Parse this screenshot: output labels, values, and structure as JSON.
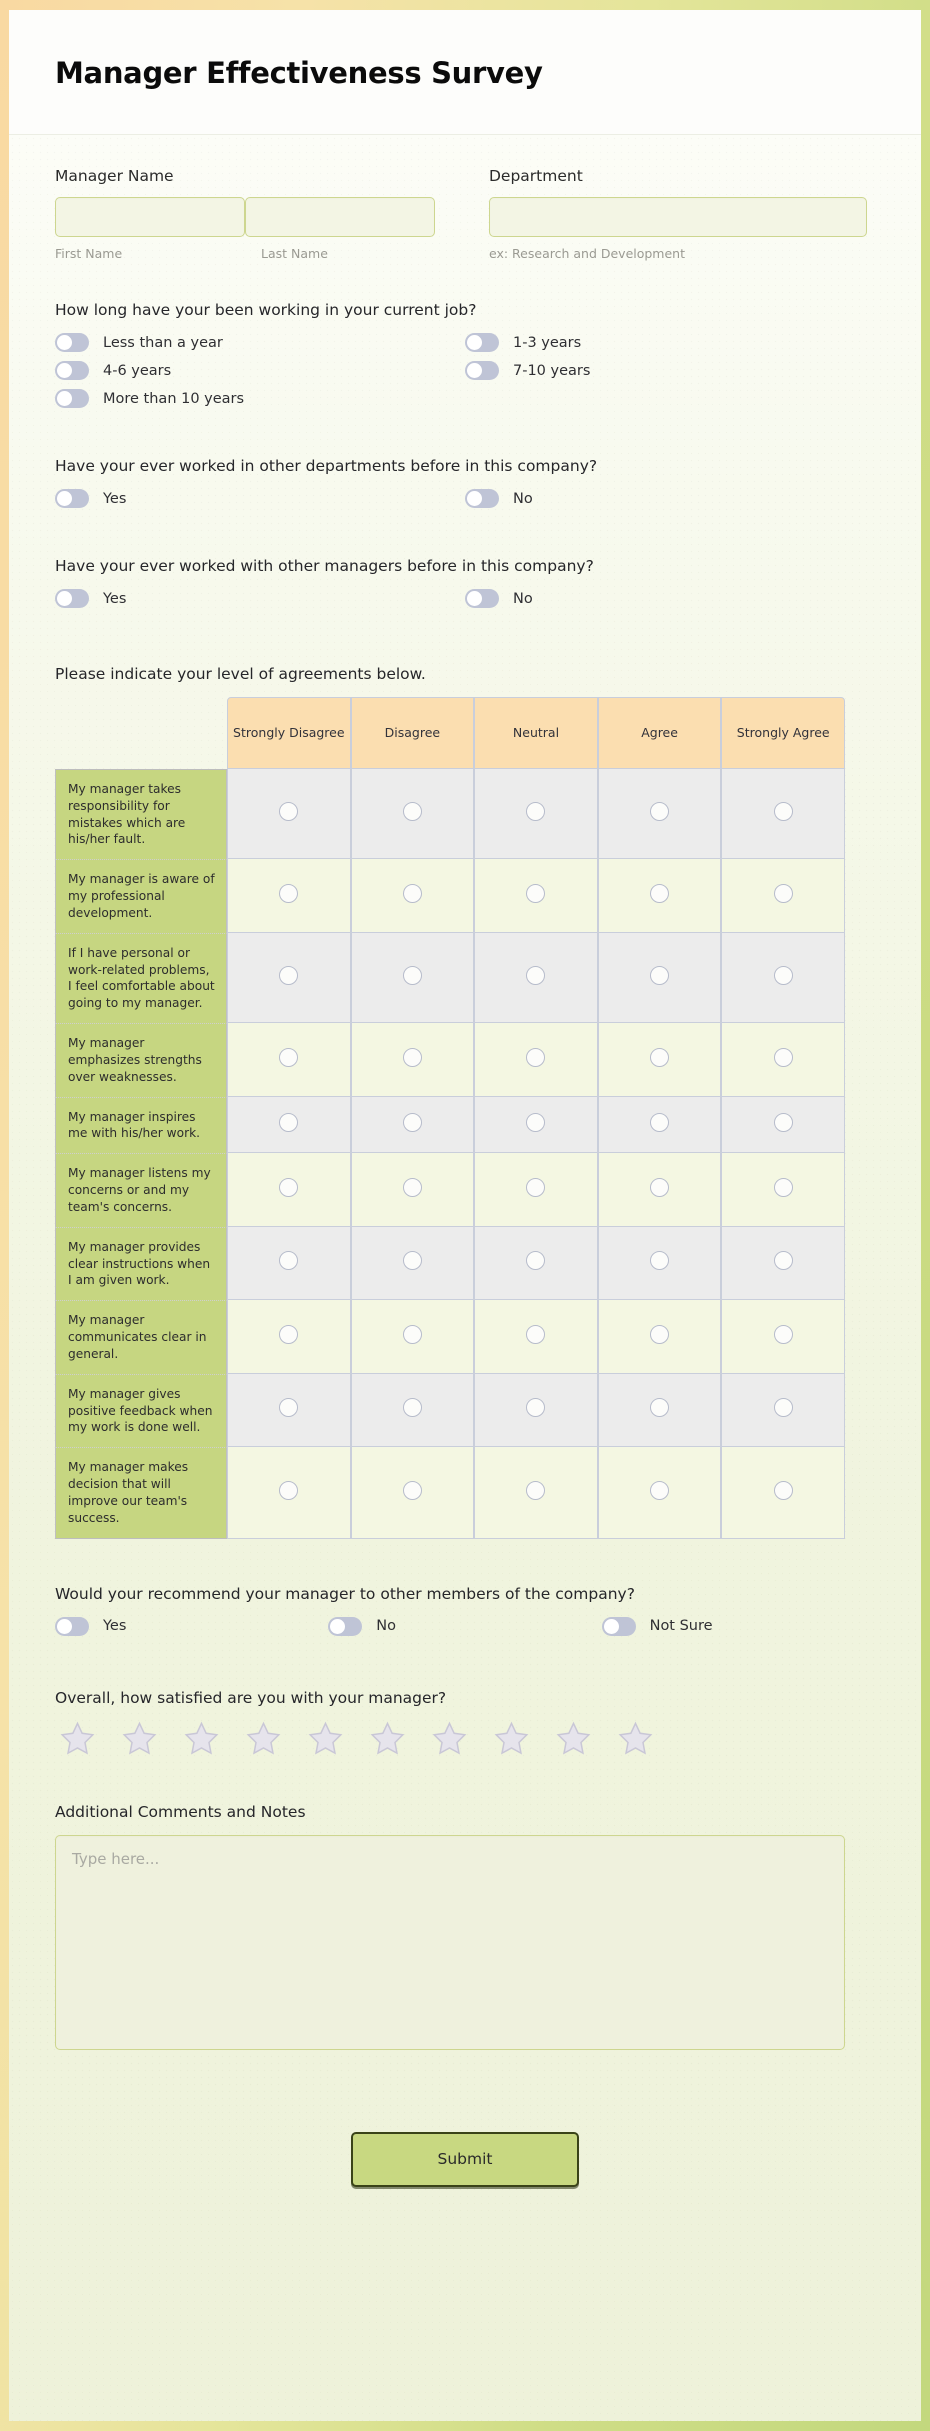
{
  "header": {
    "title": "Manager Effectiveness Survey"
  },
  "name_field": {
    "label": "Manager Name",
    "first_sub": "First Name",
    "last_sub": "Last Name",
    "first_value": "",
    "last_value": "",
    "first_placeholder": "",
    "last_placeholder": ""
  },
  "department_field": {
    "label": "Department",
    "sub": "ex: Research and Development",
    "value": "",
    "placeholder": ""
  },
  "q_tenure": {
    "text": "How long have your been working in your current job?",
    "options": [
      "Less than a year",
      "1-3 years",
      "4-6 years",
      "7-10 years",
      "More than 10 years"
    ]
  },
  "q_other_departments": {
    "text": "Have your ever worked in other departments before in this company?",
    "options": [
      "Yes",
      "No"
    ]
  },
  "q_other_managers": {
    "text": "Have your ever worked with other managers before in this company?",
    "options": [
      "Yes",
      "No"
    ]
  },
  "matrix": {
    "text": "Please indicate your level of agreements below.",
    "columns": [
      "Strongly Disagree",
      "Disagree",
      "Neutral",
      "Agree",
      "Strongly Agree"
    ],
    "rows": [
      "My manager takes responsibility for mistakes which are his/her fault.",
      "My manager is aware of my professional development.",
      "If I have personal or work-related problems, I feel comfortable about going to my manager.",
      "My manager emphasizes strengths over weaknesses.",
      "My manager inspires me with his/her work.",
      "My manager listens my concerns or and my team's concerns.",
      "My manager provides clear instructions when I am given work.",
      "My manager communicates clear in general.",
      "My manager gives positive feedback when my work is done well.",
      "My manager makes decision that will improve our team's success."
    ]
  },
  "q_recommend": {
    "text": "Would your recommend your manager to other members of the company?",
    "options": [
      "Yes",
      "No",
      "Not Sure"
    ]
  },
  "q_satisfaction": {
    "text": "Overall, how satisfied are you with your manager?",
    "star_count": 10,
    "rating": 0
  },
  "comments": {
    "label": "Additional Comments and Notes",
    "placeholder": "Type here...",
    "value": ""
  },
  "submit": {
    "label": "Submit"
  },
  "colors": {
    "accent_green": "#c6d681",
    "header_peach": "#fbdeb0",
    "toggle_track": "#bfc4d6",
    "border_green": "#cdd68f"
  }
}
